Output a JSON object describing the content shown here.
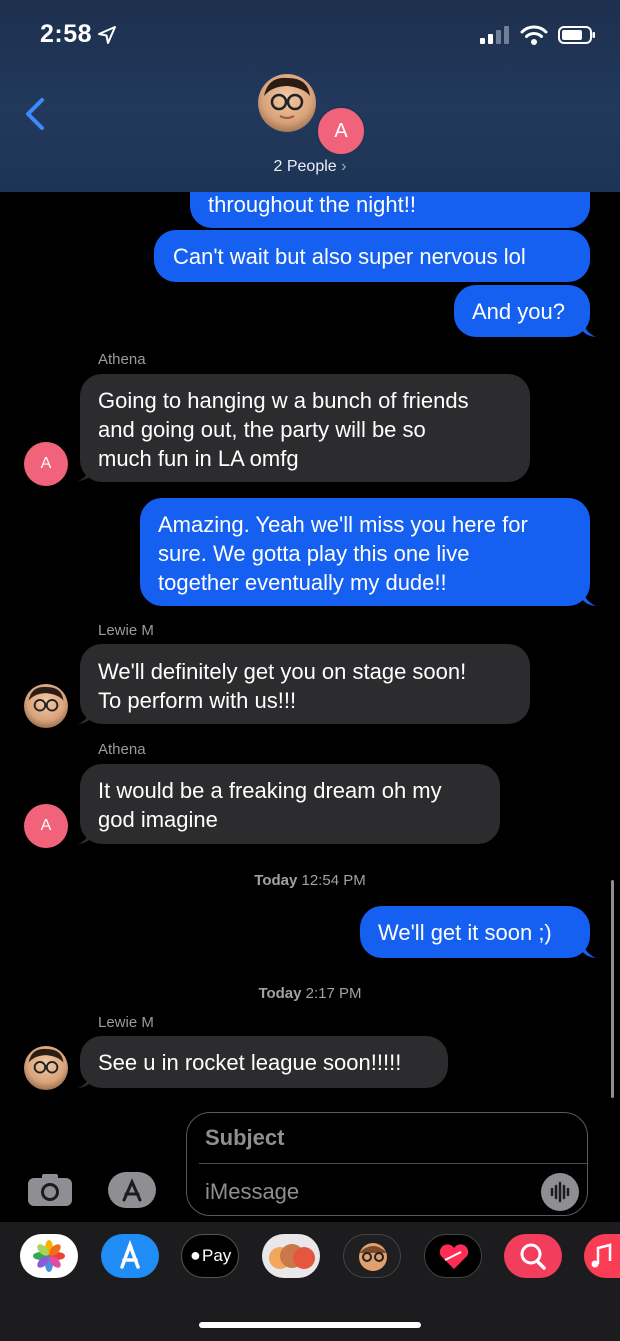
{
  "status_bar": {
    "time": "2:58"
  },
  "header": {
    "avatar_letter": "A",
    "people_label": "2 People",
    "people_chevron": "›"
  },
  "messages": [
    {
      "dir": "out",
      "text": "throughout the night!!"
    },
    {
      "dir": "out",
      "text": "Can't wait but also super nervous lol"
    },
    {
      "dir": "out",
      "text": "And you?"
    },
    {
      "dir": "in",
      "sender": "Athena",
      "avatar": "A",
      "lines": [
        "Going to hanging w a bunch of friends",
        "and going out, the party will be so",
        "much fun in LA omfg"
      ]
    },
    {
      "dir": "out",
      "lines": [
        "Amazing. Yeah we'll miss you here for",
        "sure. We gotta play this one live",
        "together eventually my dude!!"
      ]
    },
    {
      "dir": "in",
      "sender": "Lewie M",
      "lines": [
        "We'll definitely get you on stage soon!",
        "To perform with us!!!"
      ]
    },
    {
      "dir": "in",
      "sender": "Athena",
      "avatar": "A",
      "lines": [
        "It would be a freaking dream oh my",
        "god imagine"
      ]
    },
    {
      "dir": "out",
      "text": "We'll get it soon ;)"
    },
    {
      "dir": "in",
      "sender": "Lewie M",
      "text": "See u in rocket league soon!!!!!"
    }
  ],
  "timestamps": [
    {
      "day": "Today",
      "time": "12:54 PM"
    },
    {
      "day": "Today",
      "time": "2:17 PM"
    }
  ],
  "composer": {
    "subject_placeholder": "Subject",
    "message_placeholder": "iMessage"
  },
  "app_tray": {
    "icons": [
      "photos-icon",
      "app-store-icon",
      "apple-pay-icon",
      "memoji-stickers-icon",
      "memoji-icon",
      "digital-touch-icon",
      "image-search-icon",
      "music-icon"
    ],
    "pay_label": "Pay"
  },
  "colors": {
    "outgoing_bubble": "#1560f0",
    "incoming_bubble": "#2c2c2e",
    "avatar_pink": "#f0637a",
    "header_bg": "#22395c"
  }
}
